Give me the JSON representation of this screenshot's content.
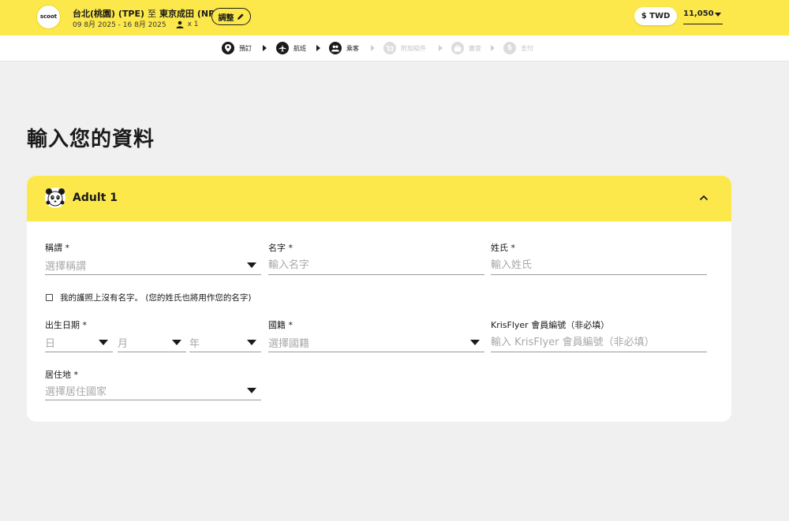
{
  "header": {
    "logo_text": "scoot",
    "route_from": "台北(桃園) (TPE)",
    "route_sep": "至",
    "route_to": "東京成田 (NRT)",
    "dates": "09 8月 2025 - 16 8月 2025",
    "passenger_count": "x 1",
    "edit_label": "調整",
    "currency": "$ TWD",
    "price": "11,050"
  },
  "steps": [
    {
      "label": "預訂",
      "active": true
    },
    {
      "label": "航班",
      "active": true
    },
    {
      "label": "乘客",
      "active": true
    },
    {
      "label": "附加組件",
      "active": false
    },
    {
      "label": "審查",
      "active": false
    },
    {
      "label": "支付",
      "active": false
    }
  ],
  "page_title": "輸入您的資料",
  "passenger": {
    "title": "Adult 1",
    "fields": {
      "salutation": {
        "label": "稱謂 *",
        "placeholder": "選擇稱謂"
      },
      "first_name": {
        "label": "名字 *",
        "placeholder": "輸入名字"
      },
      "last_name": {
        "label": "姓氏 *",
        "placeholder": "輸入姓氏"
      },
      "no_first_name": {
        "label": "我的護照上沒有名字。 (您的姓氏也將用作您的名字)"
      },
      "dob": {
        "label": "出生日期 *",
        "day": "日",
        "month": "月",
        "year": "年"
      },
      "nationality": {
        "label": "國籍 *",
        "placeholder": "選擇國籍"
      },
      "krisflyer": {
        "label": "KrisFlyer 會員編號（非必填）",
        "placeholder": "輸入 KrisFlyer 會員編號（非必填）"
      },
      "residence": {
        "label": "居住地 *",
        "placeholder": "選擇居住國家"
      }
    }
  },
  "colors": {
    "brand_yellow": "#fce84a",
    "dark": "#1a1a1a",
    "placeholder": "#a8a8a8"
  }
}
